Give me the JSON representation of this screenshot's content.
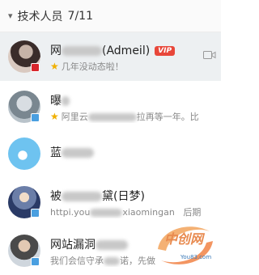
{
  "group": {
    "name": "技术人员",
    "count": "7/11"
  },
  "contacts": [
    {
      "name_visible": "网",
      "name_suffix": "(Admeil)",
      "badge": "VIP",
      "signature": "几年没动态啦！",
      "status": "red",
      "selected": true
    },
    {
      "name_visible": "曝",
      "signature_parts": [
        "阿里云",
        "拉再等一年。比"
      ],
      "status": "blue"
    },
    {
      "name_visible": "蓝",
      "signature": "",
      "status": "none"
    },
    {
      "name_visible": "被",
      "name_suffix": "黛(日梦)",
      "signature_parts": [
        "httpi.you",
        "xiaomingan",
        "后期"
      ],
      "status": "blue"
    },
    {
      "name_visible": "网站漏洞",
      "signature_parts": [
        "我们会信守承",
        "诺，先做"
      ],
      "status": "blue"
    }
  ],
  "watermark": {
    "text": "中创网",
    "sub": "You83.com"
  }
}
